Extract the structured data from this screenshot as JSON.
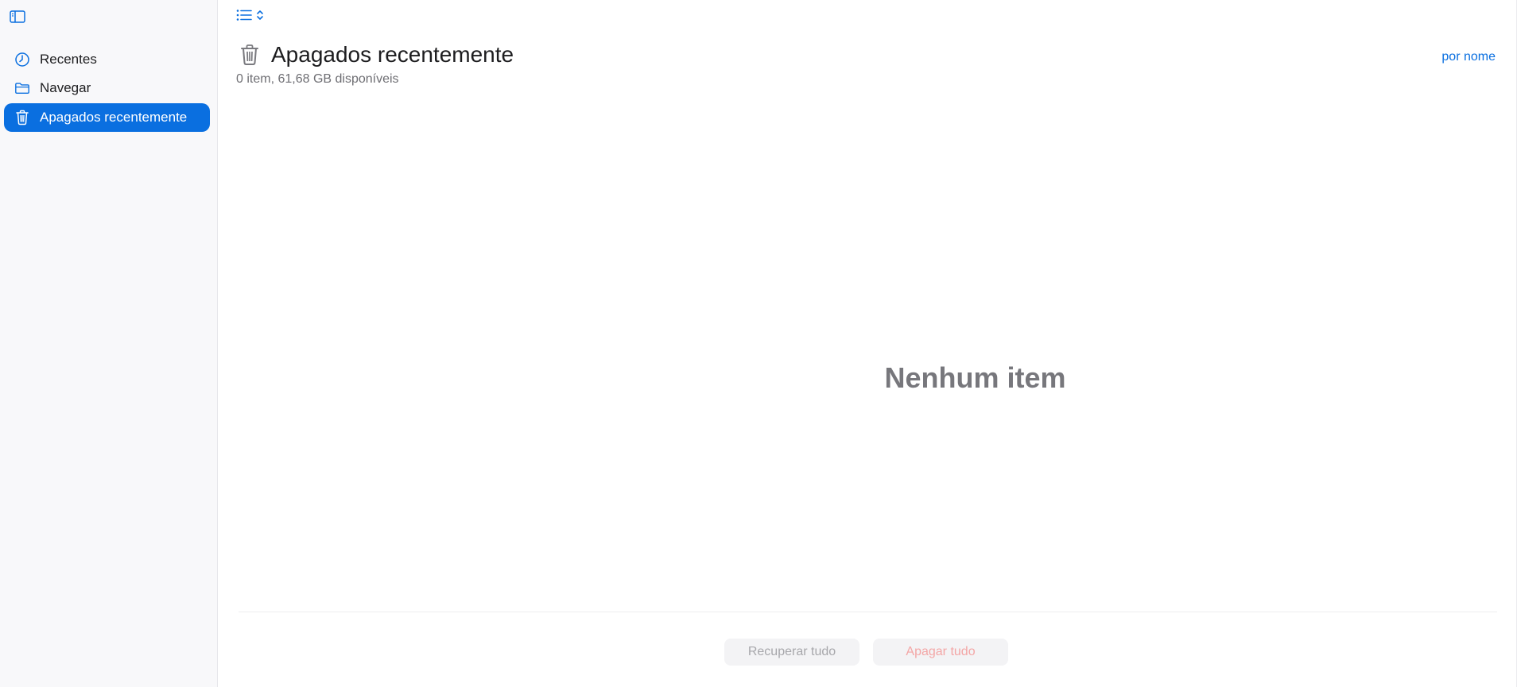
{
  "sidebar": {
    "toggle_icon": "sidebar-toggle-icon",
    "items": [
      {
        "label": "Recentes",
        "icon": "clock-icon",
        "active": false
      },
      {
        "label": "Navegar",
        "icon": "folder-icon",
        "active": false
      },
      {
        "label": "Apagados recentemente",
        "icon": "trash-icon",
        "active": true
      }
    ]
  },
  "toolbar": {
    "view_icon": "list-view-icon",
    "chevron_icon": "chevron-updown-icon"
  },
  "header": {
    "title": "Apagados recentemente",
    "subtitle": "0 item, 61,68 GB disponíveis",
    "sort_label": "por nome"
  },
  "content": {
    "empty_message": "Nenhum item"
  },
  "footer": {
    "recover_label": "Recuperar tudo",
    "delete_label": "Apagar tudo"
  },
  "colors": {
    "accent": "#0a6fe0",
    "sidebar_bg": "#f8f8fa",
    "empty_text": "#77777c",
    "delete_disabled": "#f3a6a6"
  }
}
